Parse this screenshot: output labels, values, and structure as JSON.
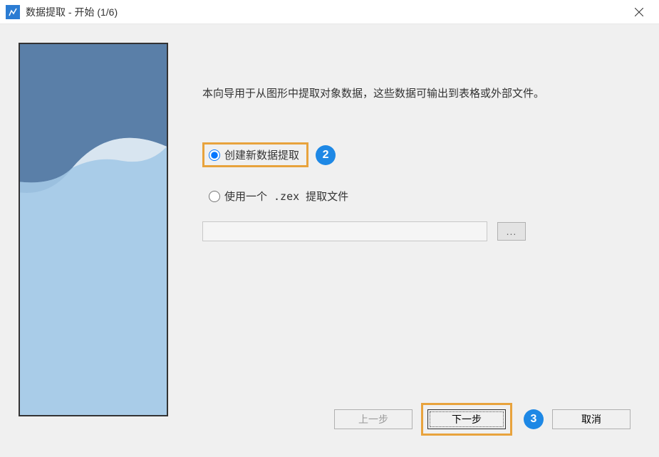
{
  "title": "数据提取 - 开始 (1/6)",
  "description": "本向导用于从图形中提取对象数据，这些数据可输出到表格或外部文件。",
  "options": {
    "create_new": "创建新数据提取",
    "use_existing": "使用一个 .zex 提取文件"
  },
  "file_input_value": "",
  "browse_label": "...",
  "buttons": {
    "prev": "上一步",
    "next": "下一步",
    "cancel": "取消"
  },
  "annotations": {
    "step2": "2",
    "step3": "3"
  }
}
